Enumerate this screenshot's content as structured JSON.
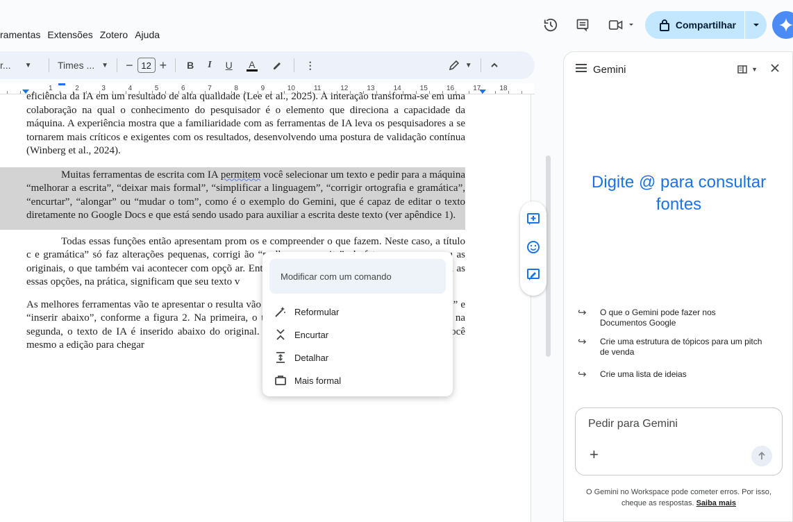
{
  "menu": [
    "ramentas",
    "Extensões",
    "Zotero",
    "Ajuda"
  ],
  "header": {
    "share_label": "Compartilhar"
  },
  "toolbar": {
    "style_label": "r...",
    "font_label": "Times ...",
    "font_size": "12",
    "bold": "B",
    "italic": "I",
    "underline": "U",
    "text_color": "A",
    "more": "⋮"
  },
  "ruler": [
    "1",
    "2",
    "3",
    "4",
    "5",
    "6",
    "7",
    "8",
    "9",
    "10",
    "11",
    "12",
    "13",
    "14",
    "15",
    "16",
    "17",
    "18"
  ],
  "document": {
    "p0_top": "eficiência da IA em um resultado de alta qualidade (Lee et al., 2025). A interação transforma-se em uma colaboração na qual o conhecimento do pesquisador é o elemento que direciona a capacidade da máquina. A experiência mostra que a familiaridade com as ferramentas de IA leva os pesquisadores a se tornarem mais críticos e exigentes com os resultados, desenvolvendo uma postura de validação contínua (Winberg et al., 2024).",
    "p1_a": "Muitas ferramentas de escrita com IA ",
    "p1_squiggle": "permitem",
    "p1_b": " você selecionar um texto e pedir para a máquina “melhorar a escrita”, “deixar mais formal”, “simplificar a linguagem”, “corrigir ortografia e gramática”, “encurtar”, “alongar” ou “mudar o tom”, como é o exemplo do Gemini,  que é capaz de editar o texto diretamente no Google Docs e que está sendo usado para auxiliar a escrita deste texto (ver apêndice 1).",
    "p2": "Todas essas funções então apresentam prom                                                              os e compreender o que fazem. Neste caso, a título c                                                              e gramática” só faz alterações pequenas, corrigi                                                             ão “melhorar a escrita”, de fato, reescreve o seu                                                             as originais, o que também vai acontecer com opçõ                                                           ar. Então, estas opções são mais significativas na m                                                            as essas opções, na prática, significam que seu texto v",
    "p3": "As melhores ferramentas vão te apresentar o resulta                                              vão te apresentar duas opções: “substituir seleção” e “inserir abaixo”, conforme a figura 2. Na primeira, o texto reescrito pela IA substitui o original e na segunda, o texto de IA é inserido abaixo do original. Prefira sempre este tipo de opção e faça você mesmo a edição para chegar"
  },
  "popup": {
    "placeholder": "Modificar com um comando",
    "items": [
      "Reformular",
      "Encurtar",
      "Detalhar",
      "Mais formal"
    ]
  },
  "gemini": {
    "title": "Gemini",
    "hero": "Digite @ para consultar fontes",
    "suggestions": [
      "O que o Gemini pode fazer nos Documentos Google",
      "Crie uma estrutura de tópicos para um pitch de venda",
      "Crie uma lista de ideias"
    ],
    "input_placeholder": "Pedir para Gemini",
    "footer": "O Gemini no Workspace pode cometer erros. Por isso, cheque as respostas.",
    "footer_link": "Saiba mais"
  }
}
